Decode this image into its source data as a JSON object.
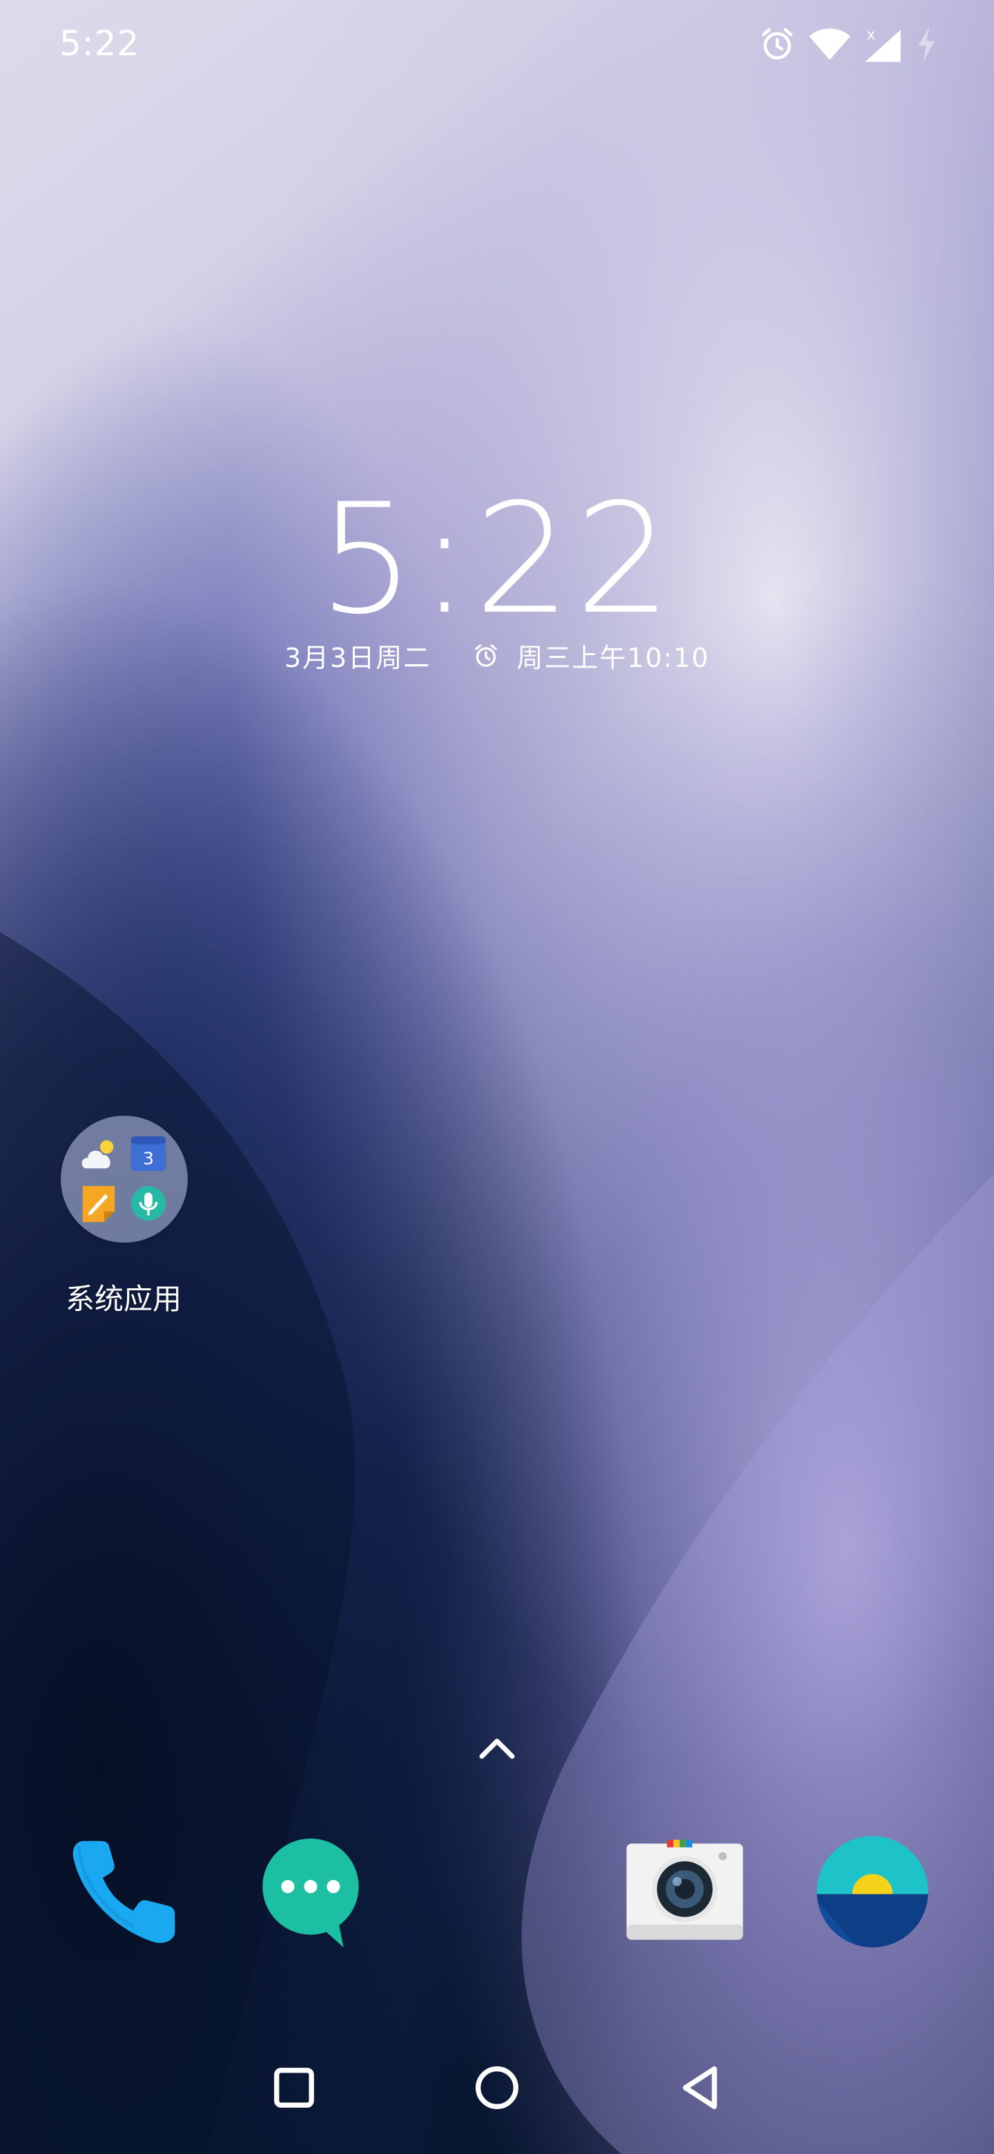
{
  "status_bar": {
    "time": "5:22",
    "icons": [
      "alarm-icon",
      "wifi-icon",
      "cellular-no-service-icon",
      "battery-charging-icon"
    ],
    "cellular_badge": "x"
  },
  "clock_widget": {
    "time": "5:22",
    "date": "3月3日周二",
    "next_alarm": "周三上午10:10"
  },
  "home_folder": {
    "label": "系统应用",
    "calendar_day": "3",
    "contents": [
      "weather-icon",
      "calendar-icon",
      "notes-icon",
      "recorder-icon"
    ]
  },
  "dock": {
    "apps": [
      "phone-icon",
      "messages-icon",
      "camera-icon",
      "weather-app-icon"
    ]
  },
  "nav_bar": {
    "buttons": [
      "recents-button",
      "home-button",
      "back-button"
    ]
  },
  "colors": {
    "phone": "#1aa8f0",
    "messages": "#1dbfa2",
    "weather_app_top": "#1ec3c9",
    "weather_app_bottom": "#114b9a",
    "sun": "#f5d21a"
  }
}
